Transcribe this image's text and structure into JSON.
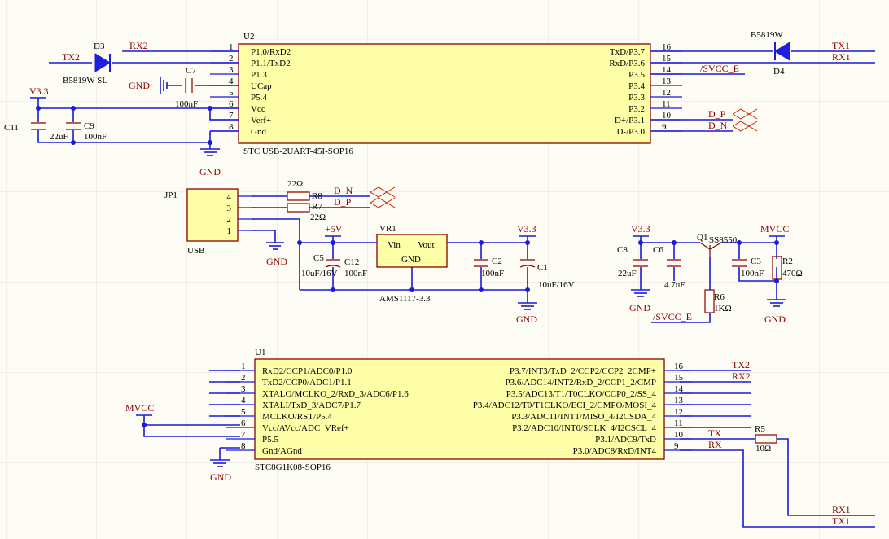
{
  "u2": {
    "ref": "U2",
    "name": "STC USB-2UART-45I-SOP16",
    "left_pins": [
      {
        "num": "1",
        "label": "P1.0/RxD2"
      },
      {
        "num": "2",
        "label": "P1.1/TxD2"
      },
      {
        "num": "3",
        "label": "P1.3"
      },
      {
        "num": "4",
        "label": "UCap"
      },
      {
        "num": "5",
        "label": "P5.4"
      },
      {
        "num": "6",
        "label": "Vcc"
      },
      {
        "num": "7",
        "label": "Verf+"
      },
      {
        "num": "8",
        "label": "Gnd"
      }
    ],
    "right_pins": [
      {
        "num": "16",
        "label": "TxD/P3.7"
      },
      {
        "num": "15",
        "label": "RxD/P3.6"
      },
      {
        "num": "14",
        "label": "P3.5"
      },
      {
        "num": "13",
        "label": "P3.4"
      },
      {
        "num": "12",
        "label": "P3.3"
      },
      {
        "num": "11",
        "label": "P3.2"
      },
      {
        "num": "10",
        "label": "D+/P3.1"
      },
      {
        "num": "9",
        "label": "D-/P3.0"
      }
    ]
  },
  "u1": {
    "ref": "U1",
    "name": "STC8G1K08-SOP16",
    "left_pins": [
      {
        "num": "1",
        "label": "RxD2/CCP1/ADC0/P1.0"
      },
      {
        "num": "2",
        "label": "TxD2/CCP0/ADC1/P1.1"
      },
      {
        "num": "3",
        "label": "XTALO/MCLKO_2/RxD_3/ADC6/P1.6"
      },
      {
        "num": "4",
        "label": "XTALI/TxD_3/ADC7/P1.7"
      },
      {
        "num": "5",
        "label": "MCLKO/RST/P5.4"
      },
      {
        "num": "6",
        "label": "Vcc/AVcc/ADC_VRef+"
      },
      {
        "num": "7",
        "label": "P5.5"
      },
      {
        "num": "8",
        "label": "Gnd/AGnd"
      }
    ],
    "right_pins": [
      {
        "num": "16",
        "label": "P3.7/INT3/TxD_2/CCP2/CCP2_2CMP+"
      },
      {
        "num": "15",
        "label": "P3.6/ADC14/INT2/RxD_2/CCP1_2/CMP"
      },
      {
        "num": "14",
        "label": "P3.5/ADC13/T1/T0CLKO/CCP0_2/SS_4"
      },
      {
        "num": "13",
        "label": "P3.4/ADC12/T0/T1CLKO/ECI_2/CMPO/MOSI_4"
      },
      {
        "num": "12",
        "label": "P3.3/ADC11/INT1/MISO_4/I2CSDA_4"
      },
      {
        "num": "11",
        "label": "P3.2/ADC10/INT0/SCLK_4/I2CSCL_4"
      },
      {
        "num": "10",
        "label": "P3.1/ADC9/TxD"
      },
      {
        "num": "9",
        "label": "P3.0/ADC8/RxD/INT4"
      }
    ]
  },
  "jp1": {
    "ref": "JP1",
    "name": "USB",
    "pins": [
      "4",
      "3",
      "2",
      "1"
    ]
  },
  "vr1": {
    "ref": "VR1",
    "name": "AMS1117-3.3",
    "vin": "Vin",
    "vout": "Vout",
    "gnd": "GND"
  },
  "q1": {
    "ref": "Q1",
    "name": "SS8550"
  },
  "diodes": {
    "d3": {
      "ref": "D3",
      "name": "B5819W SL"
    },
    "d4": {
      "ref": "D4",
      "name": "B5819W"
    }
  },
  "capacitors": {
    "c7": {
      "ref": "C7",
      "value": "100nF"
    },
    "c11": {
      "ref": "C11",
      "value": "22uF"
    },
    "c9": {
      "ref": "C9",
      "value": "100nF"
    },
    "c5": {
      "ref": "C5",
      "value": "10uF/16V"
    },
    "c12": {
      "ref": "C12",
      "value": "100nF"
    },
    "c2": {
      "ref": "C2",
      "value": "100nF"
    },
    "c1": {
      "ref": "C1",
      "value": "10uF/16V"
    },
    "c8": {
      "ref": "C8",
      "value": "22uF"
    },
    "c6": {
      "ref": "C6",
      "value": "4.7uF"
    },
    "c3": {
      "ref": "C3",
      "value": "100nF"
    }
  },
  "resistors": {
    "r8": {
      "ref": "R8",
      "value": "22Ω"
    },
    "r7": {
      "ref": "R7",
      "value": "22Ω"
    },
    "r6": {
      "ref": "R6",
      "value": "1KΩ"
    },
    "r2": {
      "ref": "R2",
      "value": "470Ω"
    },
    "r5": {
      "ref": "R5",
      "value": "10Ω"
    }
  },
  "nets": {
    "tx2": "TX2",
    "rx2": "RX2",
    "tx1": "TX1",
    "rx1": "RX1",
    "tx": "TX",
    "rx": "RX",
    "svcc_e": "/SVCC_E",
    "d_p": "D_P",
    "d_n": "D_N",
    "gnd": "GND",
    "v33": "V3.3",
    "v5": "+5V",
    "mvcc": "MVCC"
  }
}
